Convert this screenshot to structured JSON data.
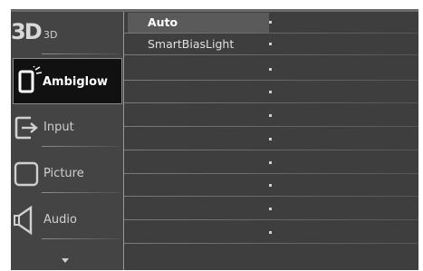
{
  "menu": {
    "left_items": [
      {
        "label": "3D",
        "icon": "3d-icon"
      },
      {
        "label": "Ambiglow",
        "icon": "ambiglow-icon"
      },
      {
        "label": "Input",
        "icon": "input-icon"
      },
      {
        "label": "Picture",
        "icon": "picture-icon"
      },
      {
        "label": "Audio",
        "icon": "audio-icon"
      }
    ],
    "three_d_glyph": "3D",
    "scroll_down_icon": "chevron-down-icon"
  },
  "submenu": {
    "options": [
      "Auto",
      "SmartBiasLight"
    ],
    "selected": "Auto"
  },
  "colors": {
    "panel": "#3e3e3e",
    "active_bg": "#111111",
    "highlight": "#5a5a5a",
    "text": "#e0e0e0"
  }
}
